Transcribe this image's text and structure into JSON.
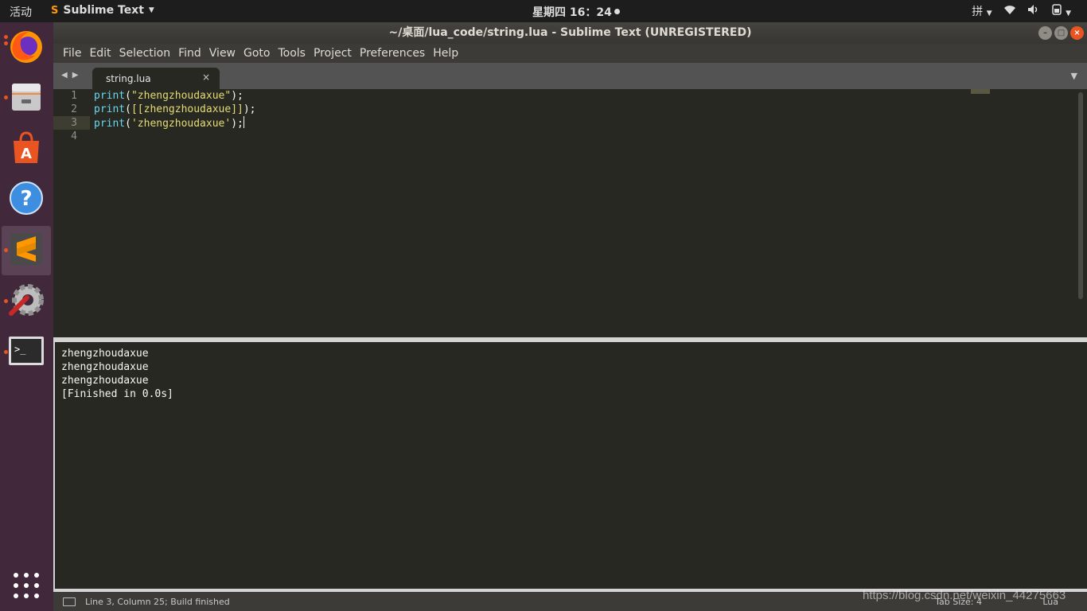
{
  "top_panel": {
    "activities": "活动",
    "app_name": "Sublime Text",
    "clock": "星期四 16：24",
    "input_method": "拼"
  },
  "window": {
    "title": "~/桌面/lua_code/string.lua - Sublime Text (UNREGISTERED)"
  },
  "menu": [
    "File",
    "Edit",
    "Selection",
    "Find",
    "View",
    "Goto",
    "Tools",
    "Project",
    "Preferences",
    "Help"
  ],
  "tab": {
    "label": "string.lua",
    "close": "×"
  },
  "editor": {
    "lines": [
      {
        "num": "1",
        "fn": "print",
        "open": "(",
        "str": "\"zhengzhoudaxue\"",
        "close": ");"
      },
      {
        "num": "2",
        "fn": "print",
        "open": "(",
        "str": "[[zhengzhoudaxue]]",
        "close": ");"
      },
      {
        "num": "3",
        "fn": "print",
        "open": "(",
        "str": "'zhengzhoudaxue'",
        "close": ");"
      },
      {
        "num": "4",
        "fn": "",
        "open": "",
        "str": "",
        "close": ""
      }
    ],
    "current_line": 3
  },
  "output": {
    "lines": [
      "zhengzhoudaxue",
      "zhengzhoudaxue",
      "zhengzhoudaxue",
      "[Finished in 0.0s]"
    ]
  },
  "status": {
    "text": "Line 3, Column 25; Build finished",
    "tab_size": "Tab Size: 4",
    "syntax": "Lua"
  },
  "watermark": "https://blog.csdn.net/weixin_44275663",
  "colors": {
    "accent": "#e95420",
    "launcher_bg": "#41283b",
    "editor_bg": "#272822",
    "keyword": "#66d9ef",
    "string": "#e6db74"
  },
  "launcher_icons": [
    "firefox-icon",
    "files-icon",
    "software-center-icon",
    "help-icon",
    "sublime-text-icon",
    "settings-icon",
    "terminal-icon",
    "show-apps-icon"
  ]
}
